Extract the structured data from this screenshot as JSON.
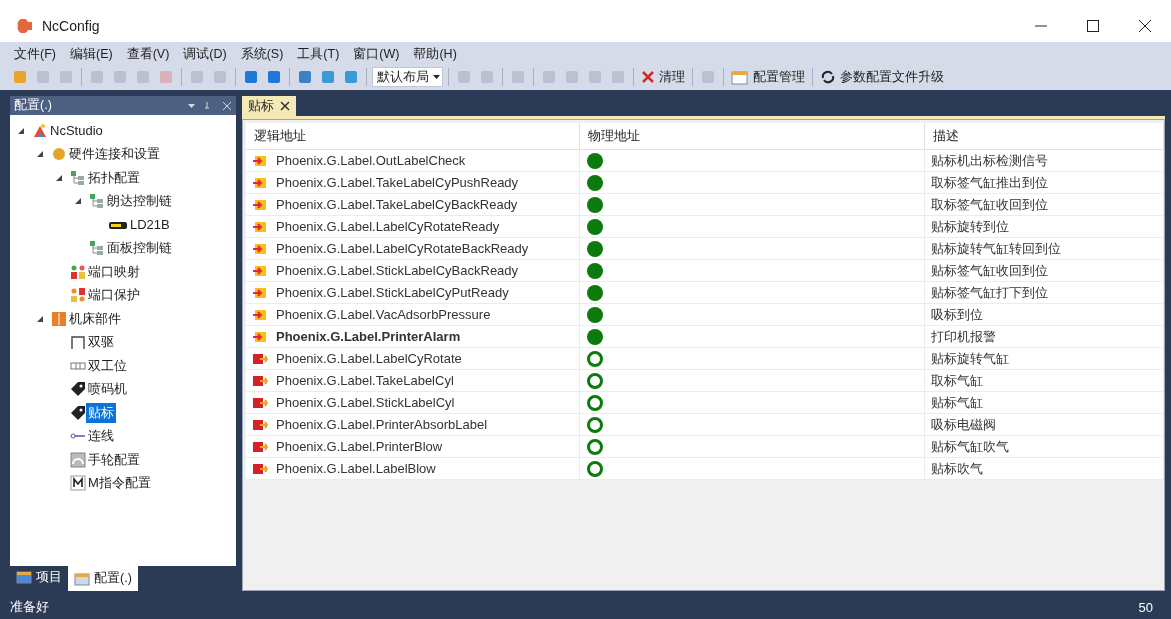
{
  "window": {
    "title": "NcConfig"
  },
  "menu": [
    "文件(F)",
    "编辑(E)",
    "查看(V)",
    "调试(D)",
    "系统(S)",
    "工具(T)",
    "窗口(W)",
    "帮助(H)"
  ],
  "toolbar": [
    {
      "kind": "icon",
      "disabled": false
    },
    {
      "kind": "icon",
      "disabled": true
    },
    {
      "kind": "icon",
      "disabled": true
    },
    {
      "kind": "sep"
    },
    {
      "kind": "icon",
      "disabled": true
    },
    {
      "kind": "icon",
      "disabled": true
    },
    {
      "kind": "icon",
      "disabled": true
    },
    {
      "kind": "icon",
      "disabled": true
    },
    {
      "kind": "sep"
    },
    {
      "kind": "icon",
      "disabled": true
    },
    {
      "kind": "icon",
      "disabled": true
    },
    {
      "kind": "sep"
    },
    {
      "kind": "icon",
      "disabled": false
    },
    {
      "kind": "icon",
      "disabled": false
    },
    {
      "kind": "sep"
    },
    {
      "kind": "icon",
      "disabled": false
    },
    {
      "kind": "icon",
      "disabled": false
    },
    {
      "kind": "icon",
      "disabled": false
    },
    {
      "kind": "sep"
    },
    {
      "kind": "combo",
      "value": "默认布局"
    },
    {
      "kind": "sep"
    },
    {
      "kind": "icon",
      "disabled": true
    },
    {
      "kind": "icon",
      "disabled": true
    },
    {
      "kind": "sep"
    },
    {
      "kind": "icon",
      "disabled": true
    },
    {
      "kind": "sep"
    },
    {
      "kind": "icon",
      "disabled": true
    },
    {
      "kind": "icon",
      "disabled": true
    },
    {
      "kind": "icon",
      "disabled": true
    },
    {
      "kind": "icon",
      "disabled": true
    },
    {
      "kind": "sep"
    },
    {
      "kind": "text",
      "label": "清理"
    },
    {
      "kind": "sep"
    },
    {
      "kind": "icon",
      "disabled": true
    },
    {
      "kind": "sep"
    },
    {
      "kind": "text",
      "label": "配置管理"
    },
    {
      "kind": "sep"
    },
    {
      "kind": "text",
      "label": "参数配置文件升级"
    }
  ],
  "side_panel": {
    "title": "配置(.)",
    "tree": [
      {
        "label": "NcStudio",
        "kind": "app",
        "expanded": true,
        "selected": false,
        "children": [
          {
            "label": "硬件连接和设置",
            "kind": "hardware",
            "expanded": true,
            "selected": false,
            "children": [
              {
                "label": "拓扑配置",
                "kind": "topology",
                "expanded": true,
                "selected": false,
                "children": [
                  {
                    "label": "朗达控制链",
                    "kind": "topology",
                    "expanded": true,
                    "selected": false,
                    "children": [
                      {
                        "label": "LD21B",
                        "kind": "device",
                        "selected": false
                      }
                    ]
                  },
                  {
                    "label": "面板控制链",
                    "kind": "topology",
                    "selected": false
                  }
                ]
              },
              {
                "label": "端口映射",
                "kind": "ports-map",
                "selected": false
              },
              {
                "label": "端口保护",
                "kind": "ports-protect",
                "selected": false
              }
            ]
          },
          {
            "label": "机床部件",
            "kind": "machine",
            "expanded": true,
            "selected": false,
            "children": [
              {
                "label": "双驱",
                "kind": "dual",
                "selected": false
              },
              {
                "label": "双工位",
                "kind": "station",
                "selected": false
              },
              {
                "label": "喷码机",
                "kind": "tag",
                "selected": false
              },
              {
                "label": "贴标",
                "kind": "tag",
                "selected": true
              },
              {
                "label": "连线",
                "kind": "link",
                "selected": false
              },
              {
                "label": "手轮配置",
                "kind": "wheel",
                "selected": false
              },
              {
                "label": "M指令配置",
                "kind": "mcmd",
                "selected": false
              }
            ]
          }
        ]
      }
    ],
    "tabs": [
      {
        "label": "项目",
        "selected": false
      },
      {
        "label": "配置(.)",
        "selected": true
      }
    ]
  },
  "document": {
    "tab": "贴标",
    "columns": [
      "逻辑地址",
      "物理地址",
      "描述"
    ],
    "rows": [
      {
        "kind": "input",
        "name": "Phoenix.G.Label.OutLabelCheck",
        "on": true,
        "bold": false,
        "description": "贴标机出标检测信号"
      },
      {
        "kind": "input",
        "name": "Phoenix.G.Label.TakeLabelCyPushReady",
        "on": true,
        "bold": false,
        "description": "取标签气缸推出到位"
      },
      {
        "kind": "input",
        "name": "Phoenix.G.Label.TakeLabelCyBackReady",
        "on": true,
        "bold": false,
        "description": "取标签气缸收回到位"
      },
      {
        "kind": "input",
        "name": "Phoenix.G.Label.LabelCyRotateReady",
        "on": true,
        "bold": false,
        "description": "贴标旋转到位"
      },
      {
        "kind": "input",
        "name": "Phoenix.G.Label.LabelCyRotateBackReady",
        "on": true,
        "bold": false,
        "description": "贴标旋转气缸转回到位"
      },
      {
        "kind": "input",
        "name": "Phoenix.G.Label.StickLabelCyBackReady",
        "on": true,
        "bold": false,
        "description": "贴标签气缸收回到位"
      },
      {
        "kind": "input",
        "name": "Phoenix.G.Label.StickLabelCyPutReady",
        "on": true,
        "bold": false,
        "description": "贴标签气缸打下到位"
      },
      {
        "kind": "input",
        "name": "Phoenix.G.Label.VacAdsorbPressure",
        "on": true,
        "bold": false,
        "description": "吸标到位"
      },
      {
        "kind": "input",
        "name": "Phoenix.G.Label.PrinterAlarm",
        "on": true,
        "bold": true,
        "description": "打印机报警"
      },
      {
        "kind": "output",
        "name": "Phoenix.G.Label.LabelCyRotate",
        "on": false,
        "bold": false,
        "description": "贴标旋转气缸"
      },
      {
        "kind": "output",
        "name": "Phoenix.G.Label.TakeLabelCyl",
        "on": false,
        "bold": false,
        "description": "取标气缸"
      },
      {
        "kind": "output",
        "name": "Phoenix.G.Label.StickLabelCyl",
        "on": false,
        "bold": false,
        "description": "贴标气缸"
      },
      {
        "kind": "output",
        "name": "Phoenix.G.Label.PrinterAbsorbLabel",
        "on": false,
        "bold": false,
        "description": "吸标电磁阀"
      },
      {
        "kind": "output",
        "name": "Phoenix.G.Label.PrinterBlow",
        "on": false,
        "bold": false,
        "description": "贴标气缸吹气"
      },
      {
        "kind": "output",
        "name": "Phoenix.G.Label.LabelBlow",
        "on": false,
        "bold": false,
        "description": "贴标吹气"
      }
    ]
  },
  "status_bar": {
    "message": "准备好",
    "value": "50"
  }
}
